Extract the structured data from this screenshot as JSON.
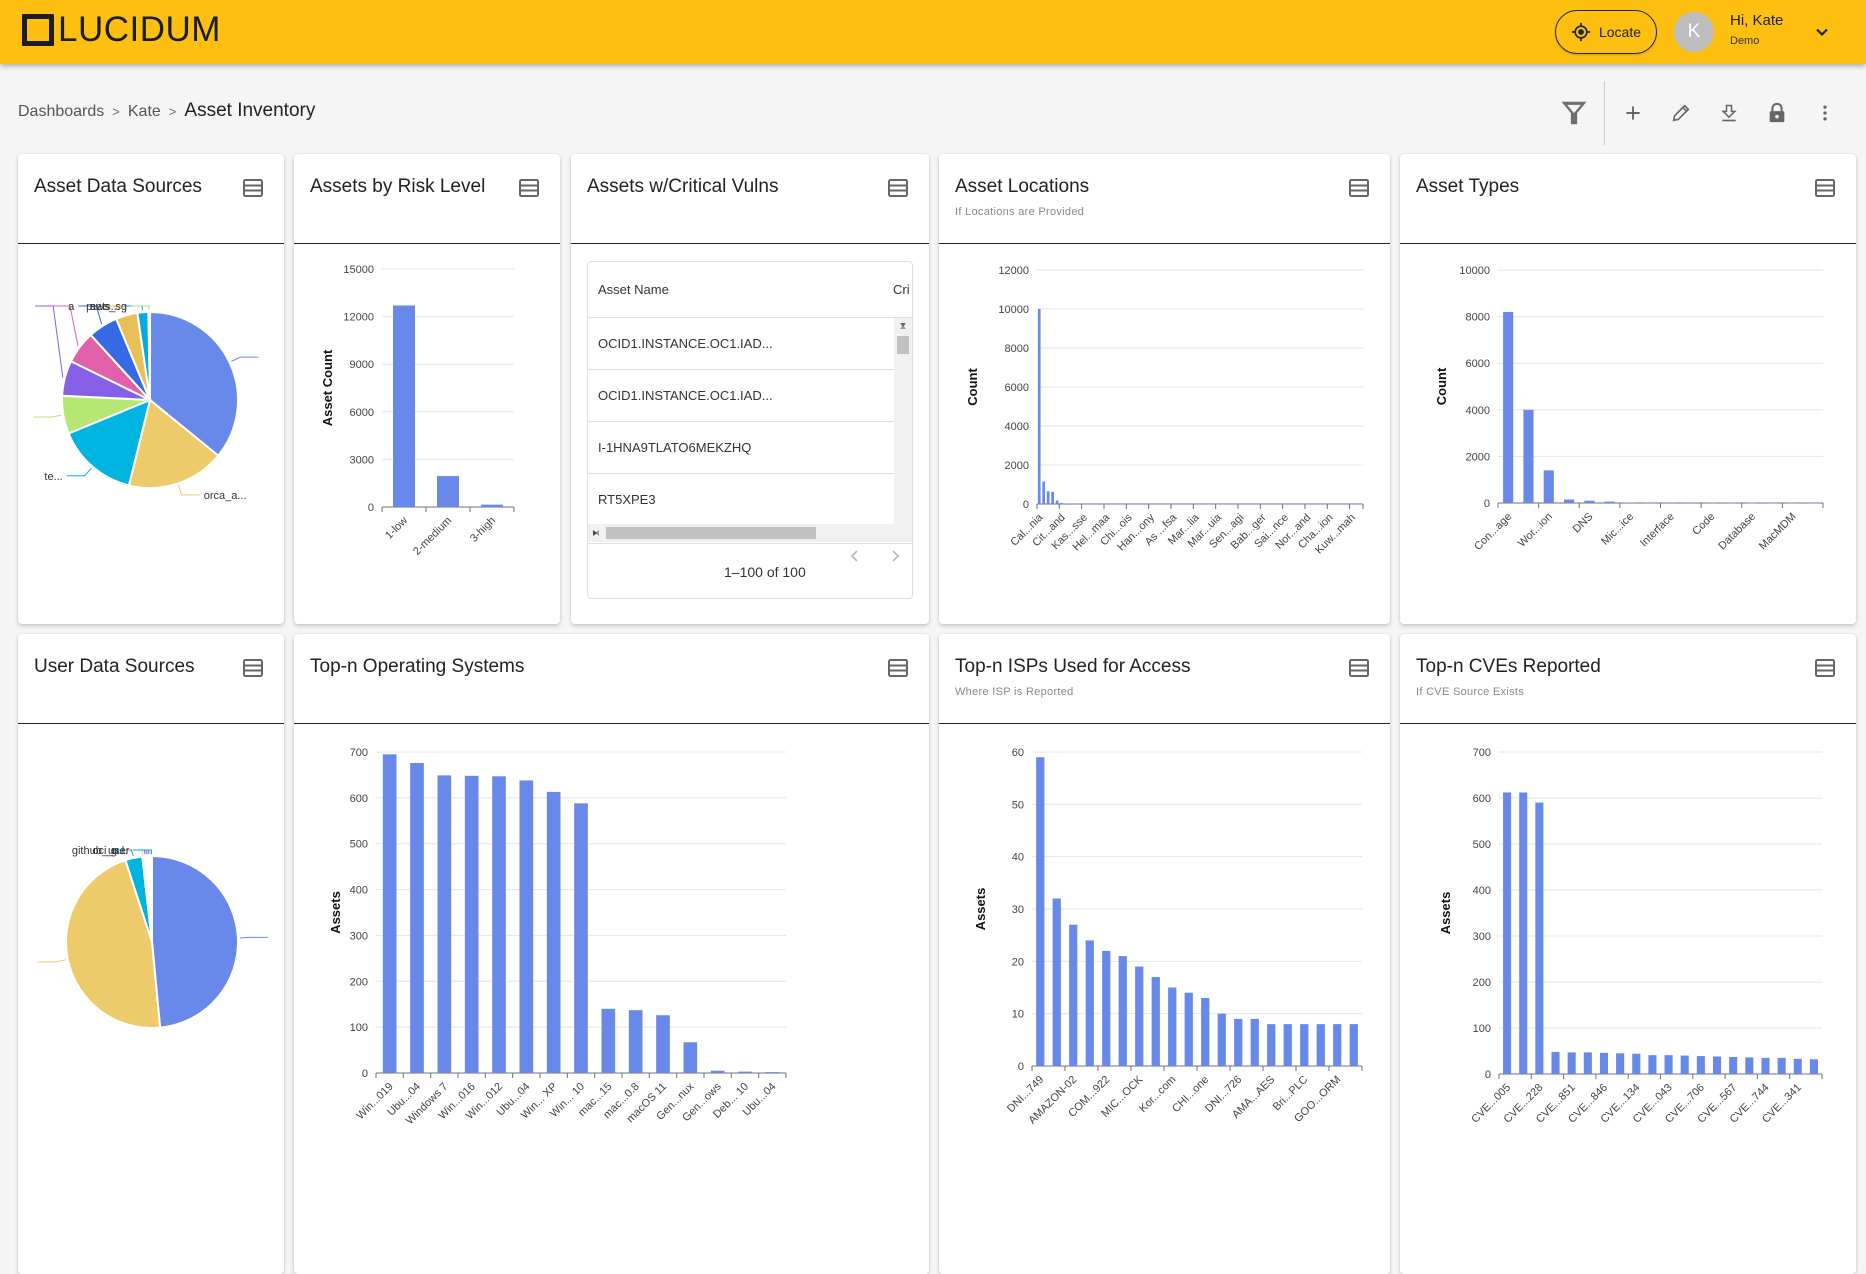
{
  "header": {
    "logo_text": "LUCIDUM",
    "locate_label": "Locate",
    "avatar_initial": "K",
    "user_greeting": "Hi, Kate",
    "user_role": "Demo"
  },
  "breadcrumb": {
    "items": [
      "Dashboards",
      "Kate"
    ],
    "separator": ">",
    "current": "Asset Inventory"
  },
  "toolbar": {
    "icons": [
      "filter-icon",
      "add-icon",
      "edit-icon",
      "download-icon",
      "lock-icon",
      "more-vert-icon"
    ]
  },
  "colors": {
    "brand": "#fdc010",
    "bar": "#6889ea",
    "grid": "#e1e6f0"
  },
  "cards": {
    "asset_data_sources": {
      "title": "Asset Data Sources"
    },
    "assets_by_risk": {
      "title": "Assets by Risk Level"
    },
    "critical_vulns": {
      "title": "Assets w/Critical Vulns",
      "columns": [
        "Asset Name",
        "Cri"
      ],
      "rows": [
        "OCID1.INSTANCE.OC1.IAD...",
        "OCID1.INSTANCE.OC1.IAD...",
        "I-1HNA9TLATO6MEKZHQ",
        "RT5XPE3"
      ],
      "pagination": "1–100 of 100"
    },
    "asset_locations": {
      "title": "Asset Locations",
      "subtitle": "If Locations are Provided"
    },
    "asset_types": {
      "title": "Asset Types"
    },
    "user_data_sources": {
      "title": "User Data Sources"
    },
    "top_os": {
      "title": "Top-n Operating Systems"
    },
    "top_isps": {
      "title": "Top-n ISPs Used for Access",
      "subtitle": "Where ISP is Reported"
    },
    "top_cves": {
      "title": "Top-n CVEs Reported",
      "subtitle": "If CVE Source Exists"
    }
  },
  "chart_data": [
    {
      "id": "asset_data_sources",
      "type": "pie",
      "title": "Asset Data Sources",
      "slices": [
        {
          "label": "",
          "value": 36,
          "color": "#6889ea"
        },
        {
          "label": "orca_a...",
          "value": 18,
          "color": "#edcb6b"
        },
        {
          "label": "te...",
          "value": 15,
          "color": "#00b4e0"
        },
        {
          "label": "",
          "value": 7,
          "color": "#b5e873"
        },
        {
          "label": "",
          "value": 6.5,
          "color": "#8560e6"
        },
        {
          "label": "",
          "value": 6,
          "color": "#e25fac"
        },
        {
          "label": "a",
          "value": 5.5,
          "color": "#3569e6"
        },
        {
          "label": "p...",
          "value": 4,
          "color": "#e8c058"
        },
        {
          "label": "nets...",
          "value": 2,
          "color": "#04a9e0"
        },
        {
          "label": "aws_sg",
          "value": 0.3,
          "color": "#9fe07a"
        }
      ]
    },
    {
      "id": "assets_by_risk",
      "type": "bar",
      "title": "Assets by Risk Level",
      "xlabel": "",
      "ylabel": "Asset Count",
      "categories": [
        "1-low",
        "2-medium",
        "3-high"
      ],
      "values": [
        12700,
        1950,
        150
      ],
      "ylim": [
        0,
        15000
      ],
      "yticks": [
        0,
        3000,
        6000,
        9000,
        12000,
        15000
      ],
      "label_every": 1,
      "grid": true
    },
    {
      "id": "asset_locations",
      "type": "bar",
      "title": "Asset Locations",
      "xlabel": "",
      "ylabel": "Count",
      "categories": [
        "Cal...nia",
        "",
        "",
        "",
        "",
        "Cit...and",
        "",
        "",
        "",
        "",
        "Kas...sse",
        "",
        "",
        "",
        "",
        "Hel...maa",
        "",
        "",
        "",
        "",
        "Chi...ois",
        "",
        "",
        "",
        "",
        "Han...ony",
        "",
        "",
        "",
        "",
        "As ...fsa",
        "",
        "",
        "",
        "",
        "Mar...lia",
        "",
        "",
        "",
        "",
        "Mar...uia",
        "",
        "",
        "",
        "",
        "Sen...agi",
        "",
        "",
        "",
        "",
        "Bab...ger",
        "",
        "",
        "",
        "",
        "Sai...nce",
        "",
        "",
        "",
        "",
        "Nor...and",
        "",
        "",
        "",
        "",
        "Cha...ion",
        "",
        "",
        "",
        "",
        "Kuw...mah",
        "",
        ""
      ],
      "values": [
        10000,
        1150,
        650,
        620,
        180,
        60,
        30,
        20,
        15,
        10,
        8,
        6,
        5,
        5,
        4,
        4,
        3,
        3,
        3,
        2,
        2,
        2,
        2,
        2,
        2,
        1,
        1,
        1,
        1,
        1,
        1,
        1,
        1,
        1,
        1,
        1,
        1,
        1,
        1,
        1,
        1,
        1,
        1,
        1,
        1,
        1,
        1,
        1,
        1,
        1,
        1,
        1,
        1,
        1,
        1,
        1,
        1,
        1,
        1,
        1,
        1,
        1,
        1,
        1,
        1,
        1,
        1,
        1,
        1,
        1,
        1,
        1,
        1
      ],
      "ylim": [
        0,
        12000
      ],
      "yticks": [
        0,
        2000,
        4000,
        6000,
        8000,
        10000,
        12000
      ],
      "grid": true
    },
    {
      "id": "asset_types",
      "type": "bar",
      "title": "Asset Types",
      "xlabel": "",
      "ylabel": "Count",
      "categories": [
        "Con...age",
        "",
        "Wor...ion",
        "",
        "DNS",
        "",
        "Mic...ice",
        "",
        "Interface",
        "",
        "Code",
        "",
        "Database",
        "",
        "MacMDM",
        ""
      ],
      "values": [
        8200,
        4000,
        1400,
        150,
        100,
        60,
        20,
        15,
        10,
        8,
        6,
        5,
        4,
        3,
        2,
        1
      ],
      "ylim": [
        0,
        10000
      ],
      "yticks": [
        0,
        2000,
        4000,
        6000,
        8000,
        10000
      ],
      "grid": true
    },
    {
      "id": "user_data_sources",
      "type": "pie",
      "title": "User Data Sources",
      "slices": [
        {
          "label": "",
          "value": 48.5,
          "color": "#6889ea"
        },
        {
          "label": "",
          "value": 46.5,
          "color": "#edcb6b"
        },
        {
          "label": "",
          "value": 3.2,
          "color": "#00b4e0"
        },
        {
          "label": "",
          "value": 0.4,
          "color": "#b5e873"
        },
        {
          "label": "",
          "value": 0.3,
          "color": "#8560e6"
        },
        {
          "label": "l",
          "value": 0.3,
          "color": "#e25fac"
        },
        {
          "label": "g...",
          "value": 0.3,
          "color": "#3569e6"
        },
        {
          "label": "oci_u...",
          "value": 0.3,
          "color": "#e8c058"
        },
        {
          "label": "github_user",
          "value": 0.2,
          "color": "#04a9e0"
        }
      ]
    },
    {
      "id": "top_os",
      "type": "bar",
      "title": "Top-n Operating Systems",
      "xlabel": "",
      "ylabel": "Assets",
      "categories": [
        "Win...019",
        "Ubu...04",
        "Windows 7",
        "Win...016",
        "Win...012",
        "Ubu...04",
        "Win... XP",
        "Win... 10",
        "mac...15",
        "mac...0.8",
        "macOS 11",
        "Gen...nux",
        "Gen...ows",
        "Deb... 10",
        "Ubu...04"
      ],
      "values": [
        695,
        676,
        649,
        648,
        647,
        638,
        613,
        588,
        140,
        137,
        126,
        67,
        5,
        3,
        2
      ],
      "ylim": [
        0,
        700
      ],
      "yticks": [
        0,
        100,
        200,
        300,
        400,
        500,
        600,
        700
      ],
      "grid": true
    },
    {
      "id": "top_isps",
      "type": "bar",
      "title": "Top-n ISPs Used for Access",
      "xlabel": "",
      "ylabel": "Assets",
      "categories": [
        "DNI...749",
        "",
        "AMAZON-02",
        "",
        "COM...922",
        "",
        "MIC...OCK",
        "",
        "Kor...com",
        "",
        "CHI...one",
        "",
        "DNI...726",
        "",
        "AMA...AES",
        "",
        "Bri...PLC",
        "",
        "GOO...ORM",
        ""
      ],
      "values": [
        59,
        32,
        27,
        24,
        22,
        21,
        19,
        17,
        15,
        14,
        13,
        10,
        9,
        9,
        8,
        8,
        8,
        8,
        8,
        8
      ],
      "ylim": [
        0,
        60
      ],
      "yticks": [
        0,
        10,
        20,
        30,
        40,
        50,
        60
      ],
      "grid": true
    },
    {
      "id": "top_cves",
      "type": "bar",
      "title": "Top-n CVEs Reported",
      "xlabel": "",
      "ylabel": "Assets",
      "categories": [
        "CVE...005",
        "",
        "CVE...228",
        "",
        "CVE...851",
        "",
        "CVE...846",
        "",
        "CVE...134",
        "",
        "CVE...043",
        "",
        "CVE...706",
        "",
        "CVE...567",
        "",
        "CVE...744",
        "",
        "CVE...341",
        ""
      ],
      "values": [
        612,
        612,
        590,
        48,
        47,
        47,
        46,
        45,
        44,
        41,
        41,
        40,
        39,
        38,
        37,
        36,
        35,
        35,
        33,
        32
      ],
      "ylim": [
        0,
        700
      ],
      "yticks": [
        0,
        100,
        200,
        300,
        400,
        500,
        600,
        700
      ],
      "grid": true
    }
  ]
}
